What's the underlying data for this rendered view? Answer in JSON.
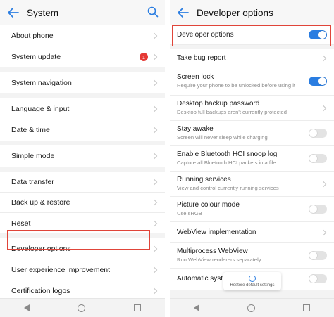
{
  "left": {
    "title": "System",
    "groups": [
      [
        {
          "label": "About phone"
        },
        {
          "label": "System update",
          "badge": "1"
        }
      ],
      [
        {
          "label": "System navigation"
        }
      ],
      [
        {
          "label": "Language & input"
        },
        {
          "label": "Date & time"
        }
      ],
      [
        {
          "label": "Simple mode"
        }
      ],
      [
        {
          "label": "Data transfer"
        },
        {
          "label": "Back up & restore"
        },
        {
          "label": "Reset"
        }
      ],
      [
        {
          "label": "Developer options"
        },
        {
          "label": "User experience improvement"
        },
        {
          "label": "Certification logos"
        }
      ]
    ]
  },
  "right": {
    "title": "Developer options",
    "rows": [
      {
        "label": "Developer options",
        "sub": "",
        "control": "toggle",
        "on": true
      },
      {
        "label": "Take bug report",
        "sub": "",
        "control": "chevron"
      },
      {
        "label": "Screen lock",
        "sub": "Require your phone to be unlocked before using it",
        "control": "toggle",
        "on": true
      },
      {
        "label": "Desktop backup password",
        "sub": "Desktop full backups aren't currently protected",
        "control": "chevron"
      },
      {
        "label": "Stay awake",
        "sub": "Screen will never sleep while charging",
        "control": "toggle",
        "on": false
      },
      {
        "label": "Enable Bluetooth HCI snoop log",
        "sub": "Capture all Bluetooth HCI packets in a file",
        "control": "toggle",
        "on": false
      },
      {
        "label": "Running services",
        "sub": "View and control currently running services",
        "control": "chevron"
      },
      {
        "label": "Picture colour mode",
        "sub": "Use sRGB",
        "control": "toggle",
        "on": false
      },
      {
        "label": "WebView implementation",
        "sub": "",
        "control": "chevron"
      },
      {
        "label": "Multiprocess WebView",
        "sub": "Run WebView renderers separately",
        "control": "toggle",
        "on": false
      },
      {
        "label": "Automatic syst",
        "sub": "",
        "control": "toggle",
        "on": false
      }
    ],
    "toast": "Restore default settings"
  },
  "colors": {
    "accent": "#2a7de1",
    "highlight": "#e0453a",
    "badge": "#e53935"
  }
}
